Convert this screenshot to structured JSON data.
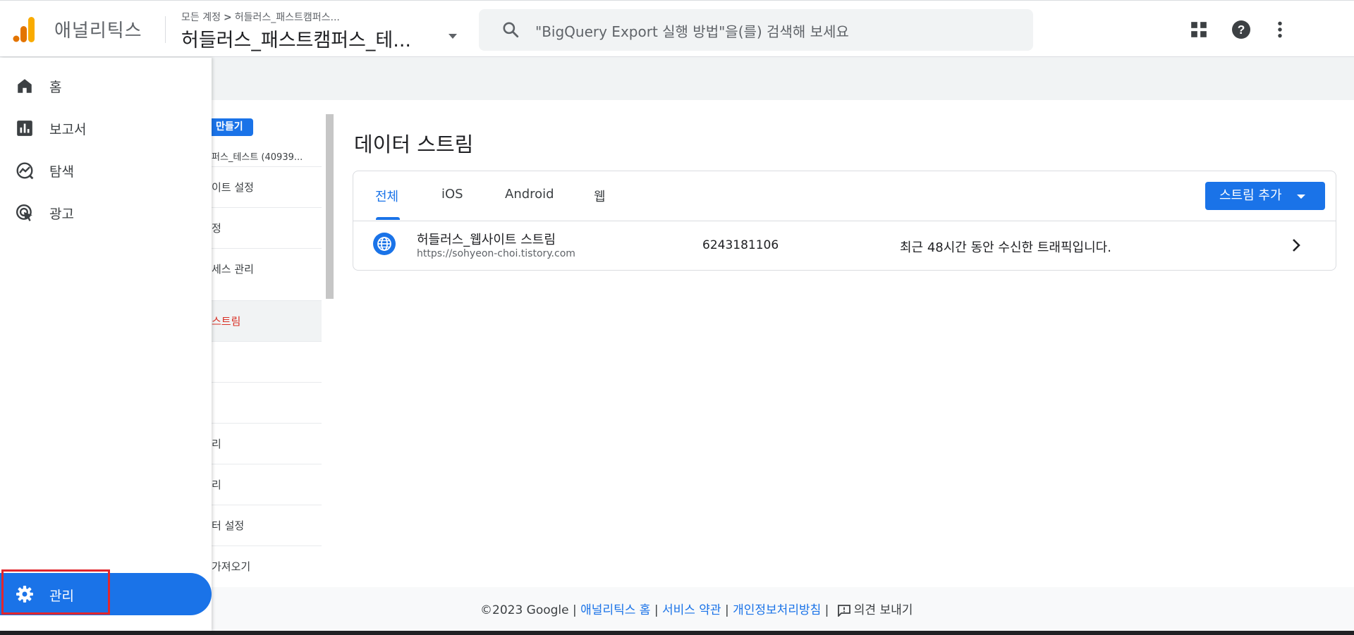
{
  "header": {
    "app_name": "애널리틱스",
    "breadcrumb_root": "모든 계정",
    "breadcrumb_separator": ">",
    "breadcrumb_account": "허들러스_패스트캠퍼스...",
    "property_name": "허들러스_패스트캠퍼스_테...",
    "search_placeholder": "\"BigQuery Export 실행 방법\"을(를) 검색해 보세요",
    "icons": [
      "apps-grid-icon",
      "help-icon",
      "more-vert-icon"
    ],
    "logo_colors": [
      "#f9ab00",
      "#e37400"
    ]
  },
  "sidebar": {
    "items": [
      {
        "label": "홈",
        "icon": "home-icon"
      },
      {
        "label": "보고서",
        "icon": "reports-icon"
      },
      {
        "label": "탐색",
        "icon": "explore-icon"
      },
      {
        "label": "광고",
        "icon": "advertising-icon"
      }
    ],
    "admin": {
      "label": "관리",
      "icon": "gear-icon",
      "active": true
    }
  },
  "admin_nav": {
    "create_label": "만들기",
    "account_line": "퍼스_테스트 (40939...",
    "items": [
      {
        "label": "이트 설정"
      },
      {
        "label": "정"
      },
      {
        "label": "세스 관리"
      },
      {
        "label": "스트림",
        "active": true
      },
      {
        "label": ""
      },
      {
        "label": ""
      },
      {
        "label": "리"
      },
      {
        "label": "리"
      },
      {
        "label": "터 설정"
      },
      {
        "label": "가져오기"
      }
    ]
  },
  "main": {
    "title": "데이터 스트림",
    "tabs": [
      {
        "label": "전체",
        "active": true
      },
      {
        "label": "iOS"
      },
      {
        "label": "Android"
      },
      {
        "label": "웹"
      }
    ],
    "add_stream_label": "스트림 추가",
    "streams": [
      {
        "name": "허들러스_웹사이트 스트림",
        "url": "https://sohyeon-choi.tistory.com",
        "id": "6243181106",
        "status": "최근 48시간 동안 수신한 트래픽입니다.",
        "icon": "globe-icon"
      }
    ]
  },
  "footer": {
    "copyright": "©2023 Google",
    "sep": "|",
    "links": [
      "애널리틱스 홈",
      "서비스 약관",
      "개인정보처리방침"
    ],
    "feedback_label": "의견 보내기"
  },
  "colors": {
    "accent": "#1a73e8",
    "highlight_border": "#e2262c"
  }
}
